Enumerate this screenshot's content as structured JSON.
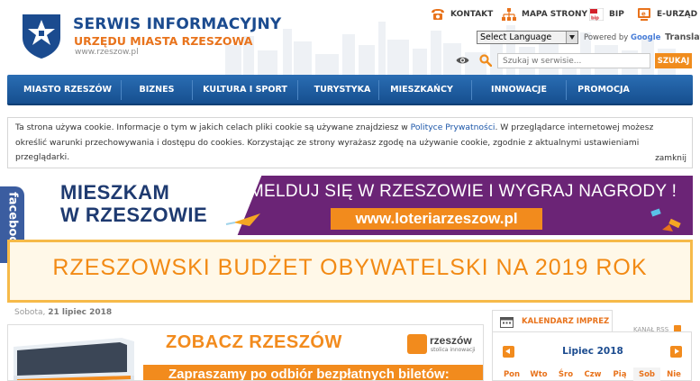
{
  "header": {
    "title": "SERWIS INFORMACYJNY",
    "subtitle": "URZĘDU MIASTA RZESZOWA",
    "url": "www.rzeszow.pl",
    "top_links": [
      {
        "label": "KONTAKT",
        "icon": "phone-icon"
      },
      {
        "label": "MAPA STRONY",
        "icon": "sitemap-icon"
      },
      {
        "label": "BIP",
        "icon": "bip-icon"
      },
      {
        "label": "E-URZĄD",
        "icon": "e-office-icon"
      }
    ],
    "language_select": "Select Language",
    "powered_by": "Powered by",
    "powered_google": "Google",
    "powered_translate": "Translate",
    "search_placeholder": "Szukaj w serwisie...",
    "search_button": "SZUKAJ"
  },
  "nav": {
    "items": [
      "MIASTO RZESZÓW",
      "BIZNES",
      "KULTURA I SPORT",
      "TURYSTYKA",
      "MIESZKAŃCY",
      "INNOWACJE",
      "PROMOCJA"
    ]
  },
  "cookie": {
    "text_before": "Ta strona używa cookie. Informacje o tym w jakich celach pliki cookie są używane znajdziesz w ",
    "link": "Polityce Prywatności",
    "text_after": ". W przeglądarce internetowej możesz określić warunki przechowywania i dostępu do cookies. Korzystając ze strony wyrażasz zgodę na używanie cookie, zgodnie z aktualnymi ustawieniami przeglądarki.",
    "close": "zamknij"
  },
  "facebook": {
    "label": "facebook"
  },
  "banner1": {
    "title_line1": "MIESZKAM",
    "title_line2": "W RZESZOWIE",
    "heading": "ZAMELDUJ SIĘ W RZESZOWIE I WYGRAJ NAGRODY !",
    "url": "www.loteriarzeszow.pl"
  },
  "banner2": {
    "text": "RZESZOWSKI BUDŻET OBYWATELSKI NA 2019 ROK"
  },
  "date": {
    "weekday": "Sobota,",
    "date": "21 lipiec 2018"
  },
  "promo": {
    "title": "ZOBACZ RZESZÓW",
    "strip": "Zapraszamy po odbiór bezpłatnych biletów:",
    "logo_name": "rzeszów",
    "logo_tag": "stolica innowacji"
  },
  "calendar": {
    "title": "KALENDARZ IMPREZ",
    "rss": "KANAŁ RSS",
    "month": "Lipiec 2018",
    "days": [
      "Pon",
      "Wto",
      "Śro",
      "Czw",
      "Pią",
      "Sob",
      "Nie"
    ]
  },
  "colors": {
    "brand_blue": "#1b4b8f",
    "accent_orange": "#f28b1d",
    "banner_purple": "#6b2476",
    "facebook_blue": "#3b5da0"
  }
}
